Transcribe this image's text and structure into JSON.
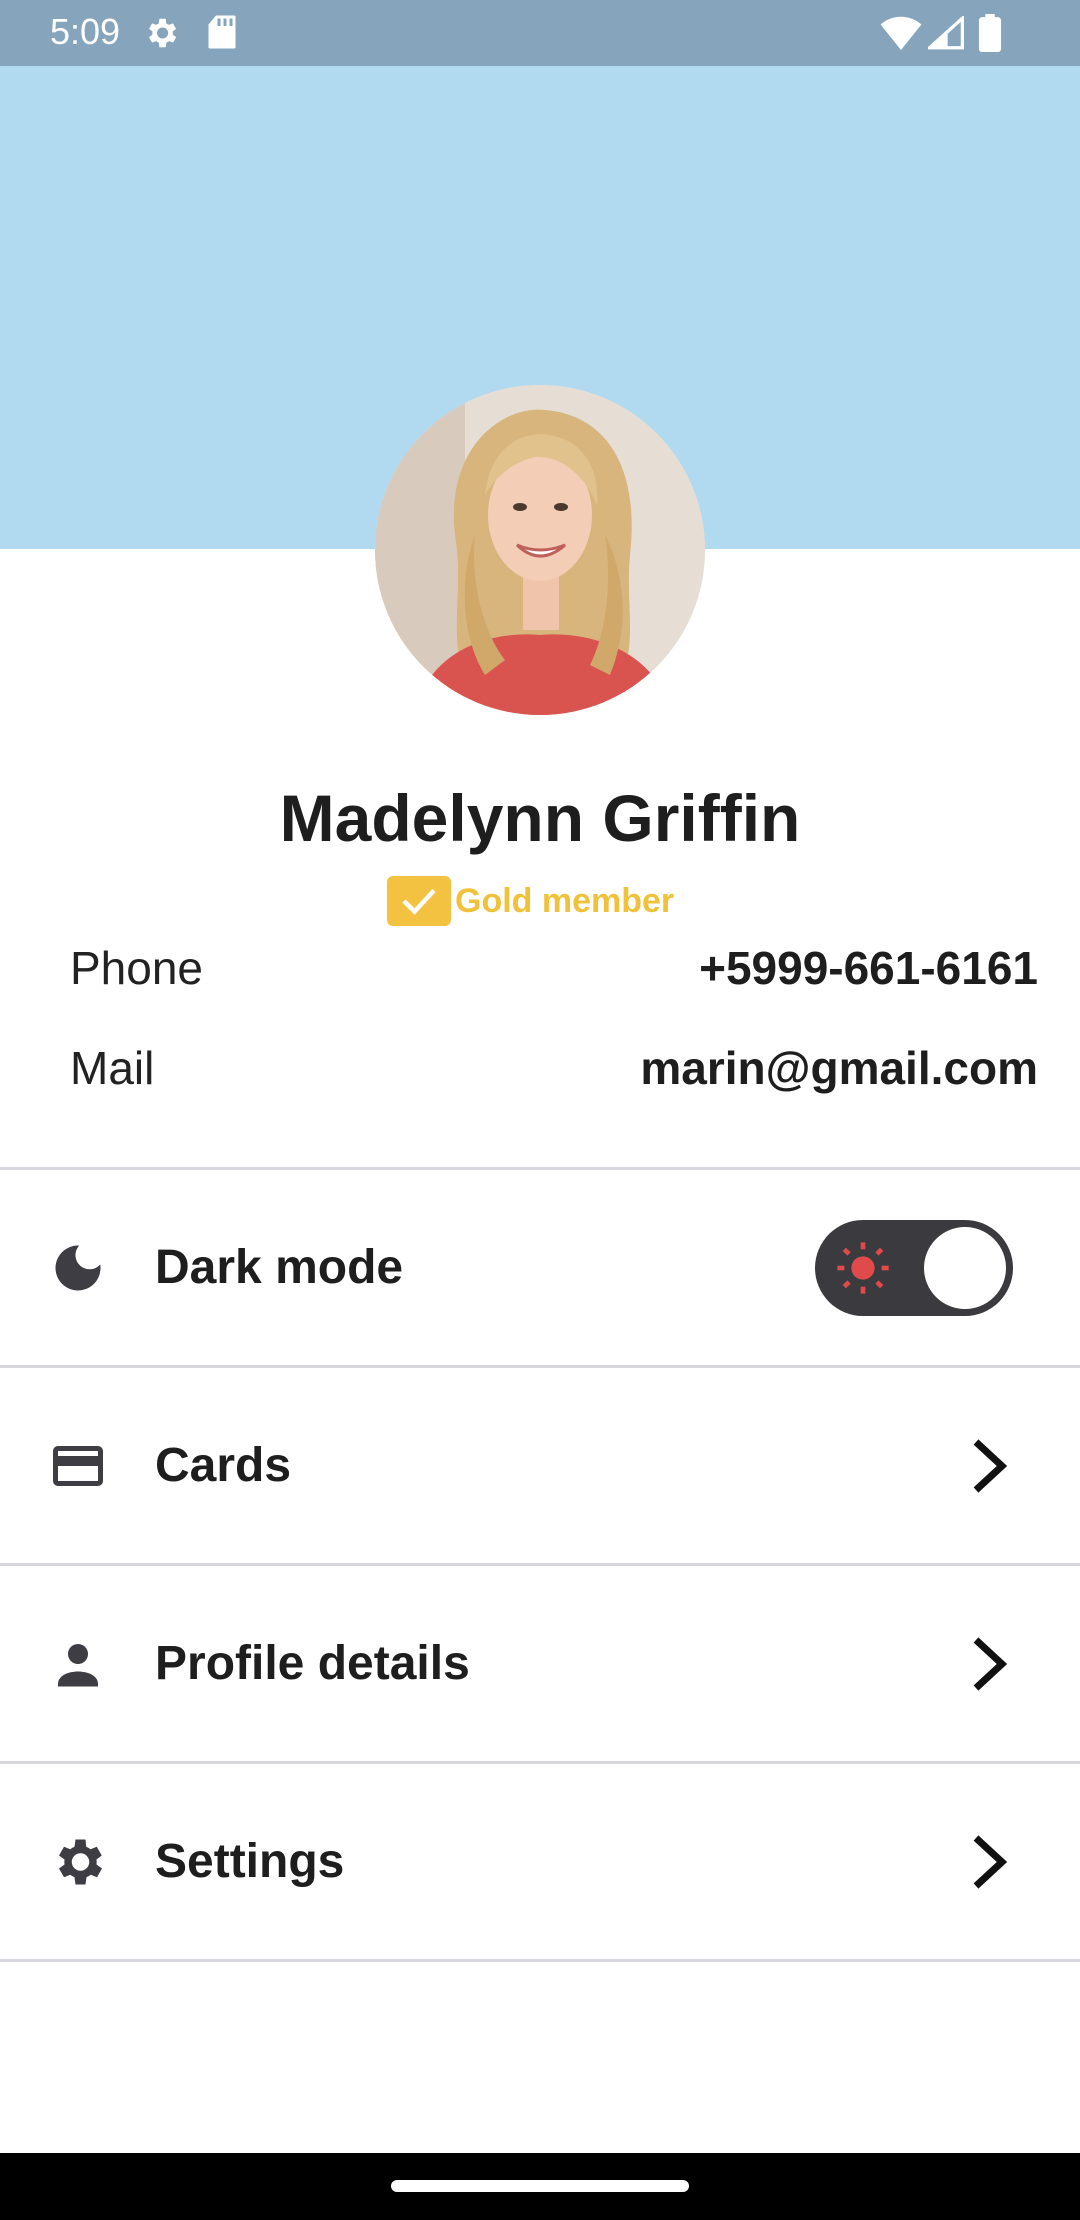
{
  "status_bar": {
    "time": "5:09"
  },
  "profile": {
    "name": "Madelynn Griffin",
    "badge": "Gold member",
    "phone_label": "Phone",
    "phone_value": "+5999-661-6161",
    "mail_label": "Mail",
    "mail_value": "marin@gmail.com"
  },
  "menu": {
    "dark_mode": {
      "label": "Dark mode",
      "icon": "moon-icon",
      "toggle_state": "off"
    },
    "items": [
      {
        "label": "Cards",
        "icon": "credit-card-icon"
      },
      {
        "label": "Profile details",
        "icon": "person-icon"
      },
      {
        "label": "Settings",
        "icon": "gear-icon"
      }
    ]
  },
  "colors": {
    "header": "#b1d9ef",
    "status_bar": "#86a5bc",
    "gold": "#f0c23b",
    "toggle_track": "#3a3a3f",
    "sun": "#e04a4a"
  }
}
